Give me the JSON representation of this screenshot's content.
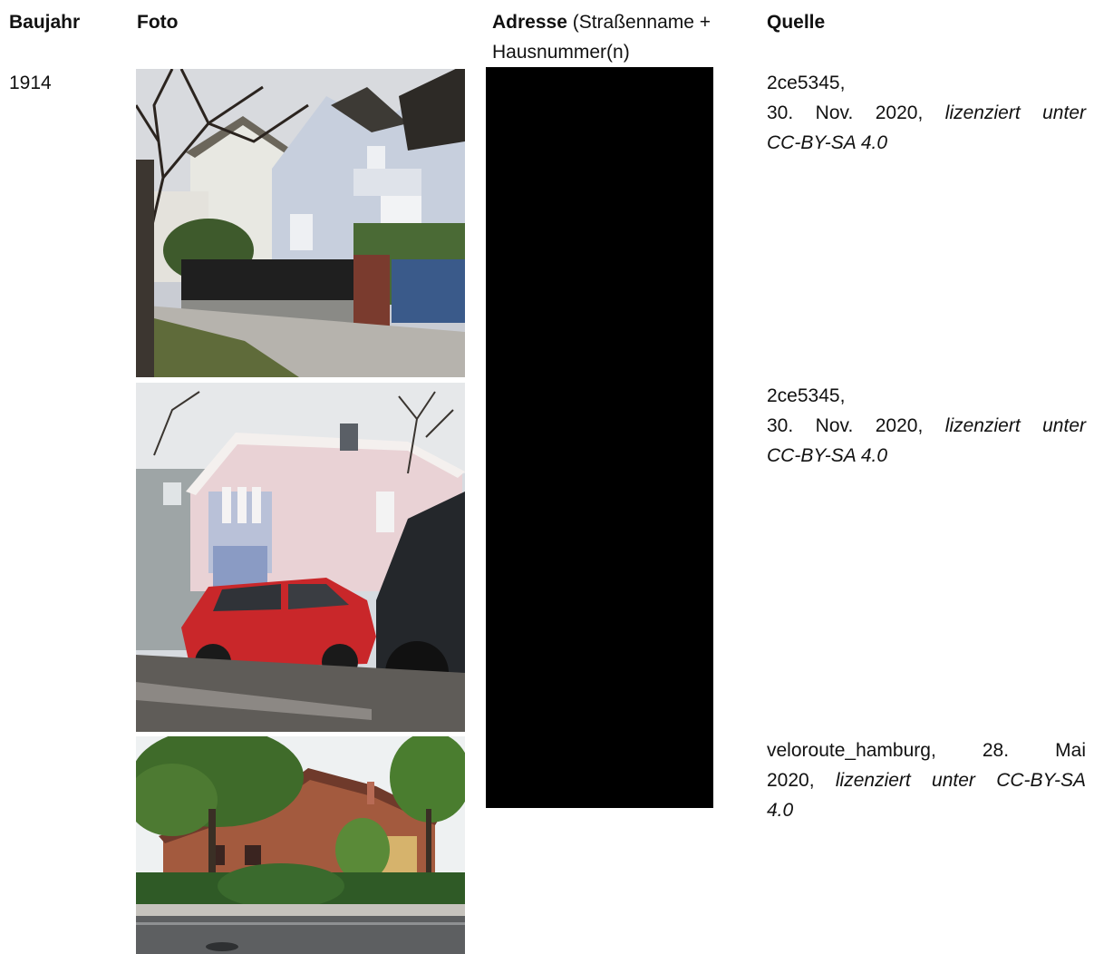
{
  "headers": {
    "year": "Baujahr",
    "photo": "Foto",
    "address_bold": "Adresse",
    "address_rest_line1": " (Straßenname +",
    "address_rest_line2": "Hausnummer(n)",
    "source": "Quelle"
  },
  "row": {
    "year": "1914",
    "photos": [
      {
        "name": "photo-villa-white-house"
      },
      {
        "name": "photo-pink-house-red-car"
      },
      {
        "name": "photo-brick-house-trees"
      }
    ],
    "address_redacted": true,
    "sources": [
      {
        "line1": "2ce5345,",
        "line2_a": "30. Nov. 2020,",
        "line2_b": "lizenziert unter",
        "line3": "CC-BY-SA 4.0"
      },
      {
        "line1": "2ce5345,",
        "line2_a": "30. Nov. 2020,",
        "line2_b": "lizenziert unter",
        "line3": "CC-BY-SA 4.0"
      },
      {
        "line1_a": "veloroute_hamburg,",
        "line1_b": "28. Mai",
        "line2_a": "2020,",
        "line2_b": "lizenziert unter CC-BY-SA",
        "line3": "4.0"
      }
    ]
  }
}
